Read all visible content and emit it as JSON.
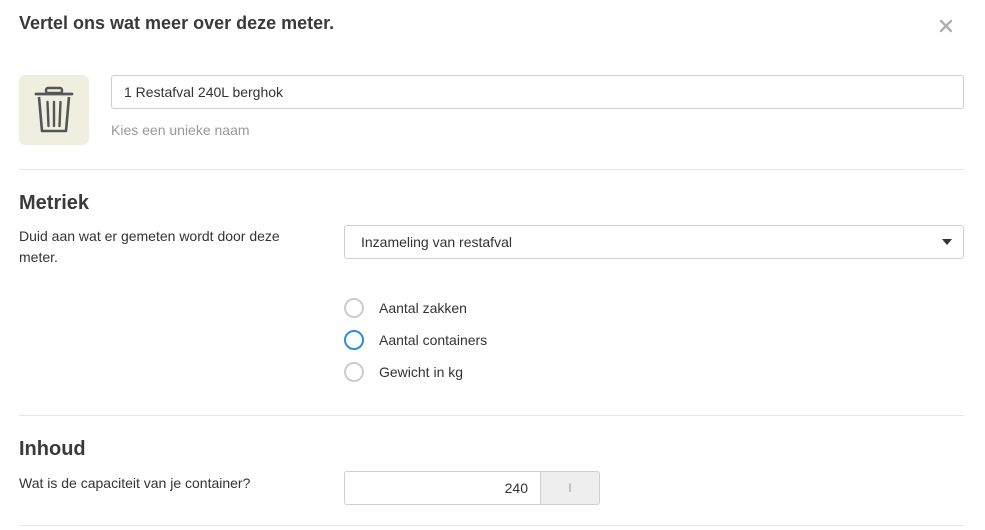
{
  "modal": {
    "title": "Vertel ons wat meer over deze meter.",
    "close_icon": "close-icon"
  },
  "meter": {
    "icon": "trash-bin-icon",
    "name_value": "1 Restafval 240L berghok",
    "name_hint": "Kies een unieke naam"
  },
  "metric": {
    "title": "Metriek",
    "description": "Duid aan wat er gemeten wordt door deze meter.",
    "select_value": "Inzameling van restafval",
    "options": [
      {
        "label": "Aantal zakken",
        "focused": false,
        "checked": false
      },
      {
        "label": "Aantal containers",
        "focused": true,
        "checked": false
      },
      {
        "label": "Gewicht in kg",
        "focused": false,
        "checked": false
      }
    ]
  },
  "content": {
    "title": "Inhoud",
    "question": "Wat is de capaciteit van je container?",
    "capacity_value": "240",
    "unit": "l"
  },
  "colors": {
    "accent": "#2d8ce0",
    "icon_tile_bg": "#f0eedf"
  }
}
